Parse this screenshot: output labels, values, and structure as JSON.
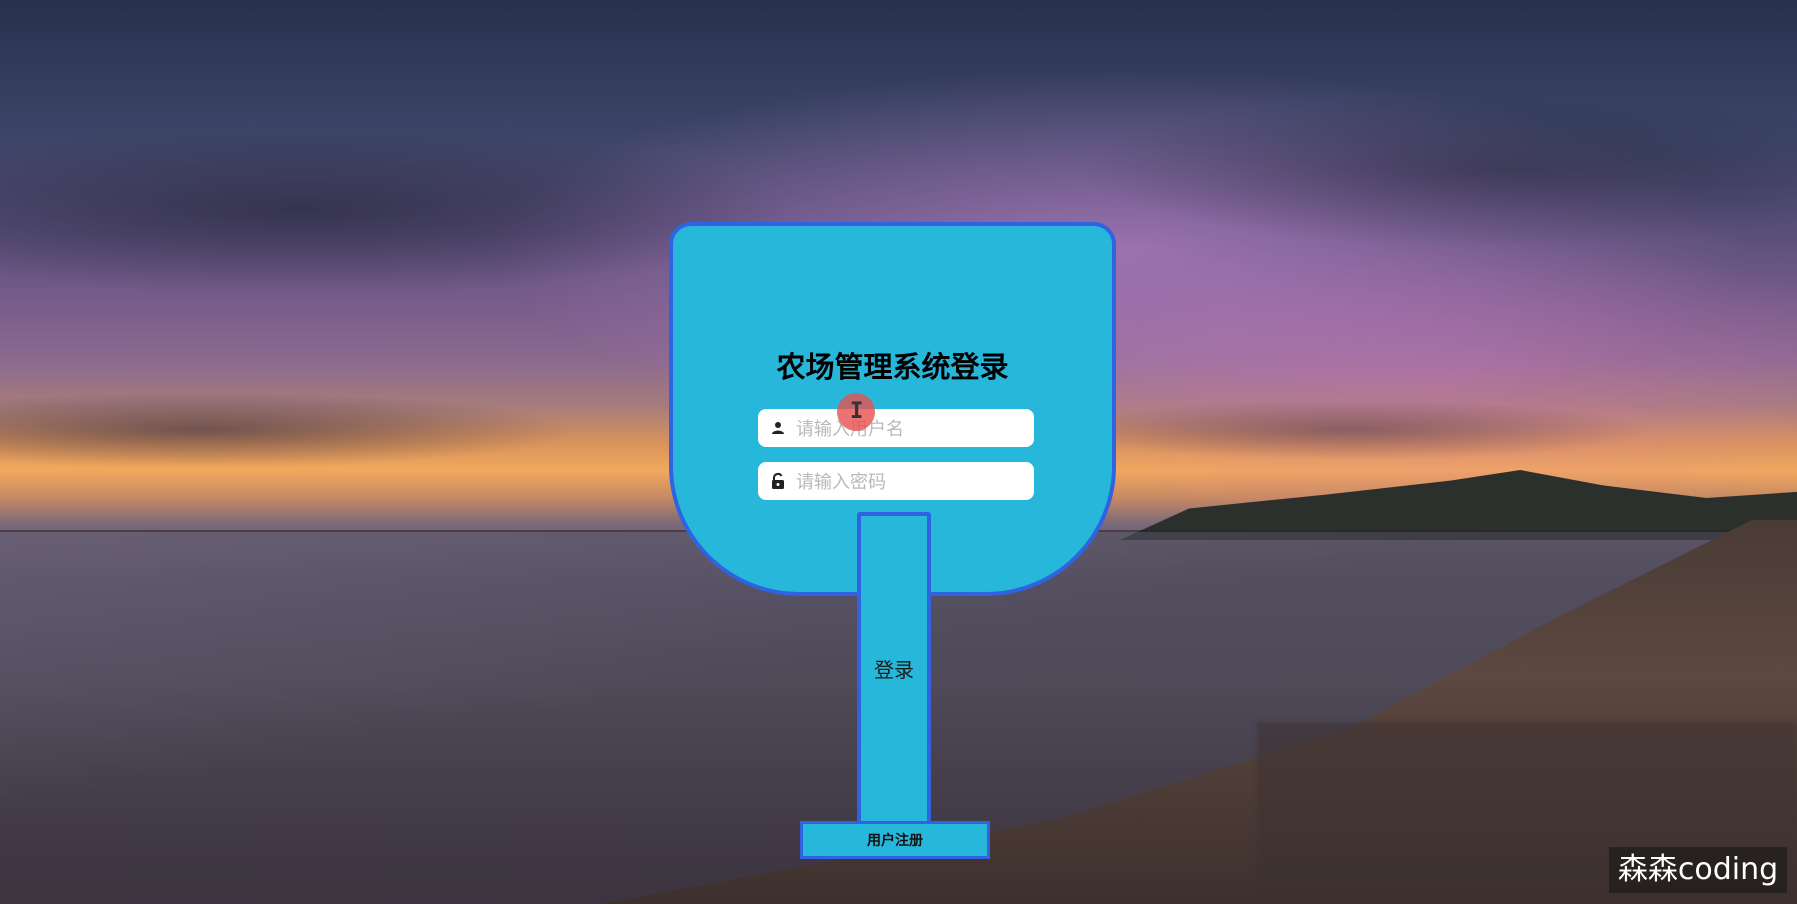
{
  "login": {
    "title": "农场管理系统登录",
    "username_placeholder": "请输入用户名",
    "password_placeholder": "请输入密码",
    "login_button": "登录",
    "register_button": "用户注册"
  },
  "watermark": {
    "text": "森森coding"
  },
  "icons": {
    "username_icon": "user-icon",
    "password_icon": "lock-icon"
  },
  "colors": {
    "card_fill": "#27b7da",
    "card_border": "#2f63e0",
    "input_fill": "#ffffff"
  }
}
